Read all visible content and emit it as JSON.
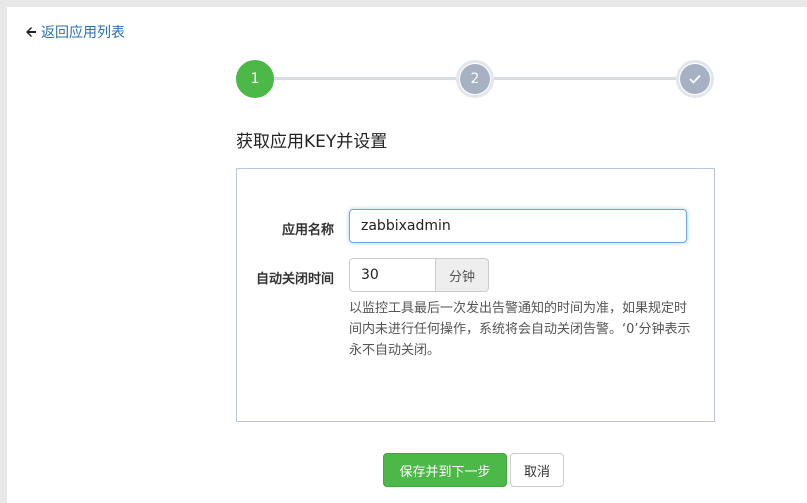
{
  "nav": {
    "back_label": "返回应用列表",
    "back_icon": "arrow-left-icon"
  },
  "stepper": {
    "steps": [
      {
        "label": "1",
        "state": "active"
      },
      {
        "label": "2",
        "state": "pending"
      },
      {
        "label": "✓",
        "state": "pending"
      }
    ],
    "active_color": "#4cb848",
    "pending_color": "#a6b2c3"
  },
  "page": {
    "title": "获取应用KEY并设置"
  },
  "form": {
    "app_name": {
      "label": "应用名称",
      "value": "zabbixadmin"
    },
    "auto_close": {
      "label": "自动关闭时间",
      "value": "30",
      "unit": "分钟",
      "help": "以监控工具最后一次发出告警通知的时间为准，如果规定时间内未进行任何操作，系统将会自动关闭告警。‘0’分钟表示永不自动关闭。"
    }
  },
  "actions": {
    "save_label": "保存并到下一步",
    "cancel_label": "取消"
  }
}
